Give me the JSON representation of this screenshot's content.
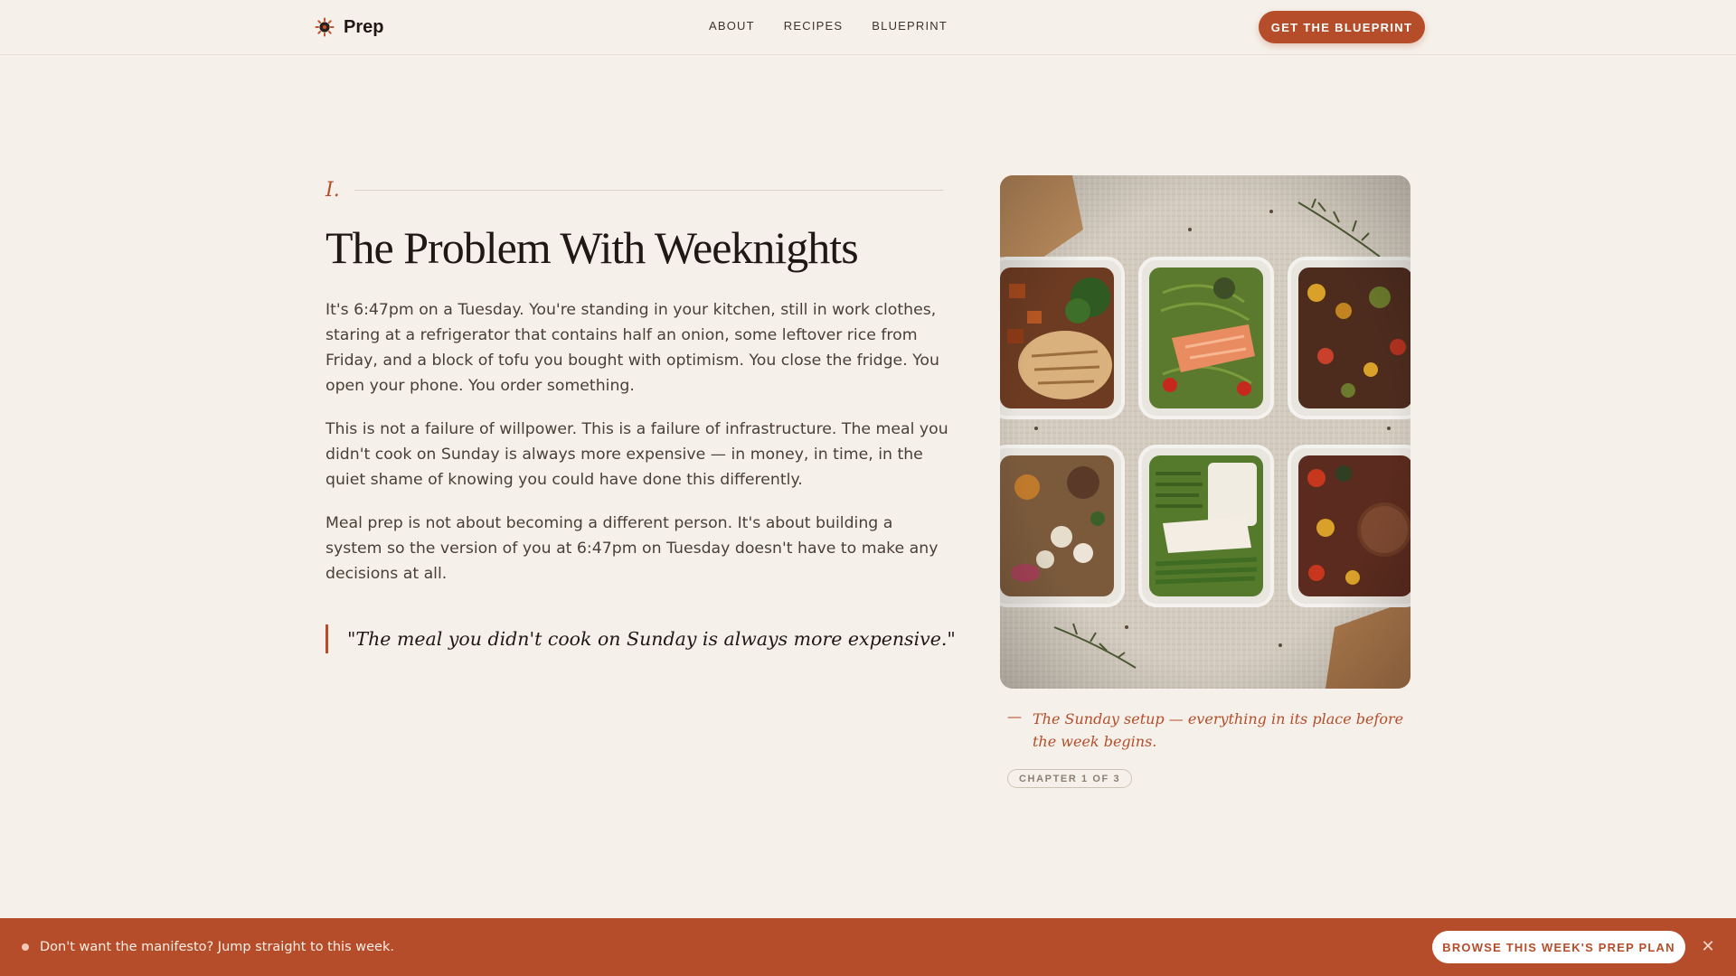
{
  "header": {
    "brand": "Prep",
    "brand_icon": "sun-icon",
    "nav": [
      "ABOUT",
      "RECIPES",
      "BLUEPRINT"
    ],
    "cta_label": "GET THE BLUEPRINT"
  },
  "chapter": {
    "numeral": "I.",
    "title": "The Problem With Weeknights",
    "paragraphs": [
      "It's 6:47pm on a Tuesday. You're standing in your kitchen, still in work clothes, staring at a refrigerator that contains half an onion, some leftover rice from Friday, and a block of tofu you bought with optimism. You close the fridge. You open your phone. You order something.",
      "This is not a failure of willpower. This is a failure of infrastructure. The meal you didn't cook on Sunday is always more expensive — in money, in time, in the quiet shame of knowing you could have done this differently.",
      "Meal prep is not about becoming a different person. It's about building a system so the version of you at 6:47pm on Tuesday doesn't have to make any decisions at all."
    ],
    "quote": "\"The meal you didn't cook on Sunday is always more expensive.\""
  },
  "figure": {
    "caption_dash": "—",
    "caption": "The Sunday setup — everything in its place before the week begins.",
    "badge": "CHAPTER 1 OF 3"
  },
  "banner": {
    "text": "Don't want the manifesto? Jump straight to this week.",
    "button_label": "BROWSE THIS WEEK'S PREP PLAN",
    "close_icon": "close-icon"
  },
  "colors": {
    "accent": "#b54d2a",
    "background": "#f5f1ea",
    "ink": "#1f1814"
  }
}
